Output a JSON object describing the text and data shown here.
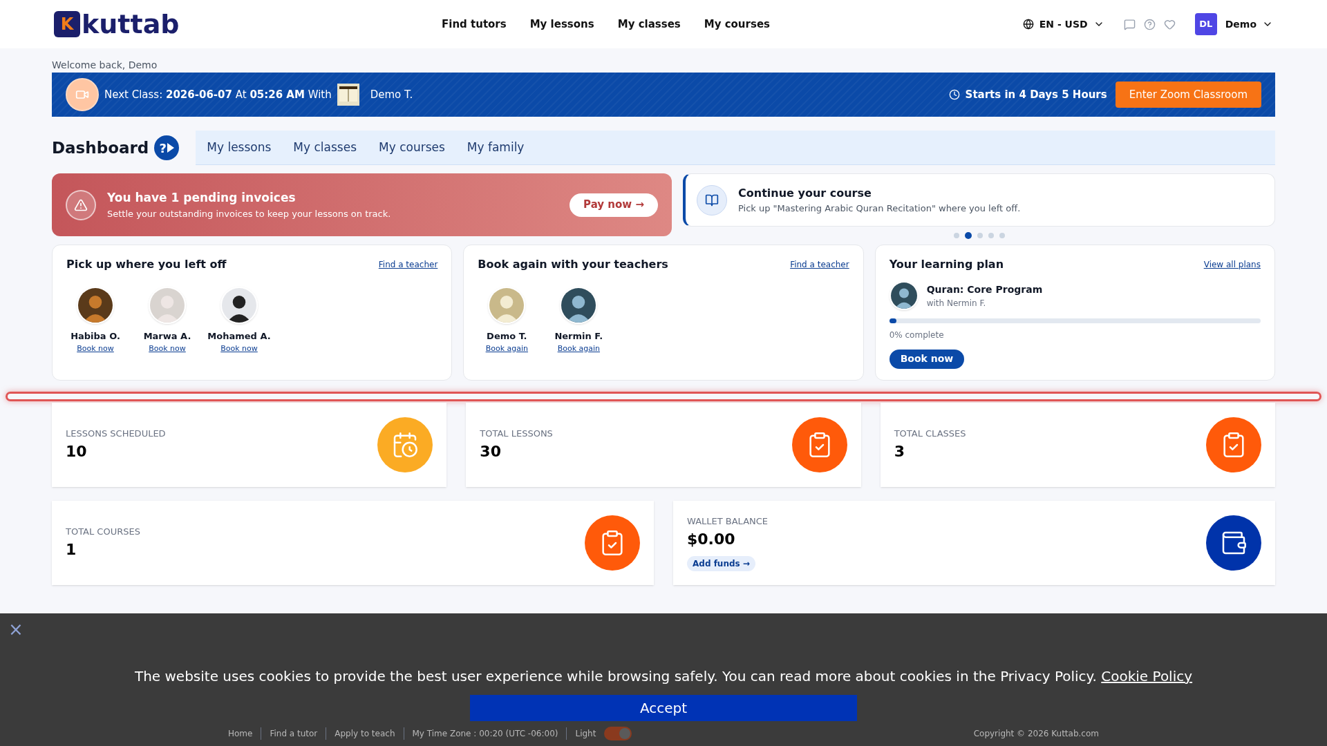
{
  "header": {
    "logo": {
      "mark": "K",
      "text": "kuttab"
    },
    "nav": [
      {
        "label": "Find tutors",
        "selected": false
      },
      {
        "label": "My lessons",
        "selected": false
      },
      {
        "label": "My classes",
        "selected": false
      },
      {
        "label": "My courses",
        "selected": false
      }
    ],
    "locale": "EN - USD",
    "user": {
      "initials": "DL",
      "name": "Demo"
    }
  },
  "welcome": "Welcome back, Demo",
  "next_class": {
    "text": "Next Class: **2026-06-07** At **05:26 AM** With",
    "teacher": "Demo T.",
    "countdown": "Starts in 4 Days 5 Hours",
    "button": "Enter Zoom Classroom"
  },
  "dashboard": {
    "title": "Dashboard",
    "help": "?",
    "tabs": [
      {
        "label": "My lessons",
        "selected": false
      },
      {
        "label": "My classes",
        "selected": false
      },
      {
        "label": "My courses",
        "selected": false
      },
      {
        "label": "My family",
        "selected": false
      }
    ]
  },
  "alerts": {
    "invoice": {
      "title": "You have 1 pending invoices",
      "text": "Settle your outstanding invoices to keep your lessons on track.",
      "button": "Pay now →"
    },
    "course": {
      "title": "Continue your course",
      "text": "Pick up \"Mastering Arabic Quran Recitation\" where you left off."
    },
    "dots": [
      {
        "selected": false
      },
      {
        "selected": true
      },
      {
        "selected": false
      },
      {
        "selected": false
      },
      {
        "selected": false
      }
    ]
  },
  "pick_up": {
    "title": "Pick up where you left off",
    "link": "Find a teacher",
    "teachers": [
      {
        "name": "Habiba O.",
        "action": "Book now"
      },
      {
        "name": "Marwa A.",
        "action": "Book now"
      },
      {
        "name": "Mohamed A.",
        "action": "Book now"
      }
    ]
  },
  "book_again": {
    "title": "Book again with your teachers",
    "link": "Find a teacher",
    "teachers": [
      {
        "name": "Demo T.",
        "action": "Book again"
      },
      {
        "name": "Nermin F.",
        "action": "Book again"
      }
    ]
  },
  "plan": {
    "title": "Your learning plan",
    "link": "View all plans",
    "program": "Quran: Core Program",
    "teacher": "with Nermin F.",
    "level": 0.02,
    "progress": "0% complete",
    "button": "Book now"
  },
  "stats": [
    {
      "label": "LESSONS SCHEDULED",
      "value": "10",
      "kind": "calendar",
      "color": "#fbab24"
    },
    {
      "label": "TOTAL LESSONS",
      "value": "30",
      "kind": "clipboard",
      "color": "#ff5a0a"
    },
    {
      "label": "TOTAL CLASSES",
      "value": "3",
      "kind": "clipboard",
      "color": "#ff5a0a"
    },
    {
      "label": "TOTAL COURSES",
      "value": "1",
      "kind": "clipboard",
      "color": "#ff5a0a"
    },
    {
      "label": "WALLET BALANCE",
      "value": "$0.00",
      "kind": "wallet",
      "color": "#0033aa",
      "action": "Add funds →"
    }
  ],
  "footer": {
    "links": [
      "Home",
      "Find a tutor",
      "Apply to teach",
      "My Time Zone : 00:20 (UTC -06:00)"
    ],
    "theme": "Light",
    "theme_toggle": {
      "on": true
    },
    "copyright": "Copyright © 2026 Kuttab.com"
  },
  "cookie": {
    "text": "The website uses cookies to provide the best user experience while browsing safely. You can read more about cookies in the Privacy Policy.",
    "link": "Cookie Policy",
    "button": "Accept",
    "close": "×"
  }
}
